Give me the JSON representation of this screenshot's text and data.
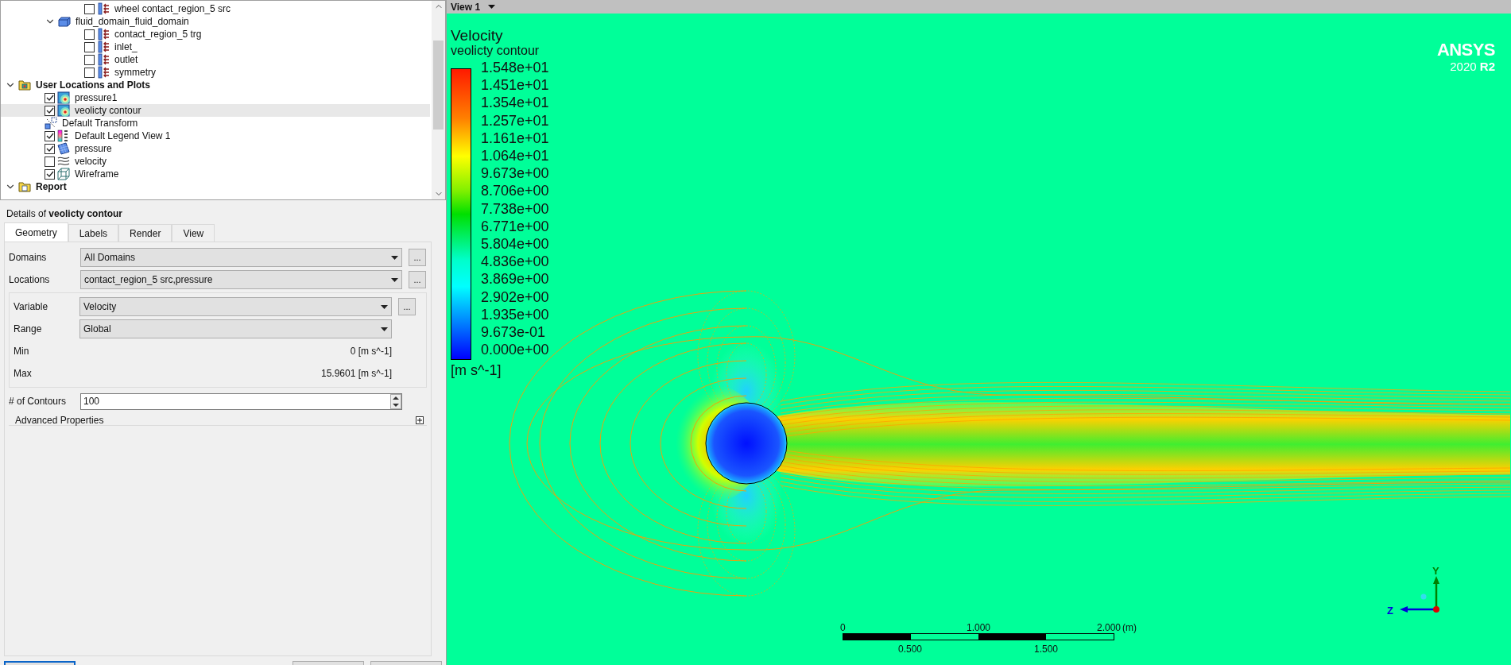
{
  "tree": [
    {
      "label": "wheel contact_region_5 src",
      "kind": "boundary",
      "checked": false,
      "selected": false
    },
    {
      "label": "fluid_domain_fluid_domain",
      "kind": "domain",
      "expanded": true,
      "selected": false,
      "children": [
        {
          "label": "contact_region_5 trg",
          "kind": "boundary",
          "checked": false,
          "selected": false
        },
        {
          "label": "inlet_",
          "kind": "boundary",
          "checked": false,
          "selected": false
        },
        {
          "label": "outlet",
          "kind": "boundary",
          "checked": false,
          "selected": false
        },
        {
          "label": "symmetry",
          "kind": "boundary",
          "checked": false,
          "selected": false
        }
      ]
    },
    {
      "label": "User Locations and Plots",
      "kind": "folder",
      "expanded": true,
      "selected": false,
      "children": [
        {
          "label": "pressure1",
          "kind": "contour",
          "checked": true,
          "selected": false
        },
        {
          "label": "veolicty contour",
          "kind": "contour",
          "checked": true,
          "selected": true
        },
        {
          "label": "Default Transform",
          "kind": "transform",
          "selected": false
        },
        {
          "label": "Default Legend View 1",
          "kind": "legend",
          "checked": true,
          "selected": false
        },
        {
          "label": "pressure",
          "kind": "plane",
          "checked": true,
          "selected": false
        },
        {
          "label": "velocity",
          "kind": "streamline",
          "checked": false,
          "selected": false
        },
        {
          "label": "Wireframe",
          "kind": "wireframe",
          "checked": true,
          "selected": false
        }
      ]
    },
    {
      "label": "Report",
      "kind": "report",
      "expanded": true,
      "selected": false
    }
  ],
  "details": {
    "title": "Details of **veolicty contour**",
    "tabs": [
      {
        "label": "Geometry",
        "selected": true
      },
      {
        "label": "Labels",
        "selected": false
      },
      {
        "label": "Render",
        "selected": false
      },
      {
        "label": "View",
        "selected": false
      }
    ],
    "fields": [
      {
        "kind": "dropdown",
        "label": "Domains",
        "value": "All Domains",
        "more": "..."
      },
      {
        "kind": "dropdown",
        "label": "Locations",
        "value": "contact_region_5 src,pressure",
        "more": "..."
      }
    ],
    "variable_group": [
      {
        "kind": "dropdown",
        "label": "Variable",
        "value": "Velocity",
        "more": "..."
      },
      {
        "kind": "dropdown",
        "label": "Range",
        "value": "Global"
      },
      {
        "kind": "readout",
        "label": "Min",
        "value": "0 [m s^-1]"
      },
      {
        "kind": "readout",
        "label": "Max",
        "value": "15.9601 [m s^-1]"
      }
    ],
    "contours": {
      "label": "# of Contours",
      "value": "100"
    },
    "advanced": {
      "label": "Advanced Properties",
      "expanded": false
    }
  },
  "viewport": {
    "title": "View 1",
    "legend": {
      "title": "Velocity",
      "subtitle": "veolicty contour",
      "labels": [
        "1.548e+01",
        "1.451e+01",
        "1.354e+01",
        "1.257e+01",
        "1.161e+01",
        "1.064e+01",
        "9.673e+00",
        "8.706e+00",
        "7.738e+00",
        "6.771e+00",
        "5.804e+00",
        "4.836e+00",
        "3.869e+00",
        "2.902e+00",
        "1.935e+00",
        "9.673e-01",
        "0.000e+00"
      ],
      "units": "[m s^-1]"
    },
    "logo": {
      "name": "ANSYS",
      "version": "2020 **R2**"
    },
    "scale_bar": {
      "top_labels": [
        "0",
        "1.000",
        "2.000"
      ],
      "unit": "(m)",
      "bottom_labels": [
        "0.500",
        "1.500"
      ]
    },
    "axes": {
      "vertical": "Y",
      "horizontal": "Z"
    }
  }
}
